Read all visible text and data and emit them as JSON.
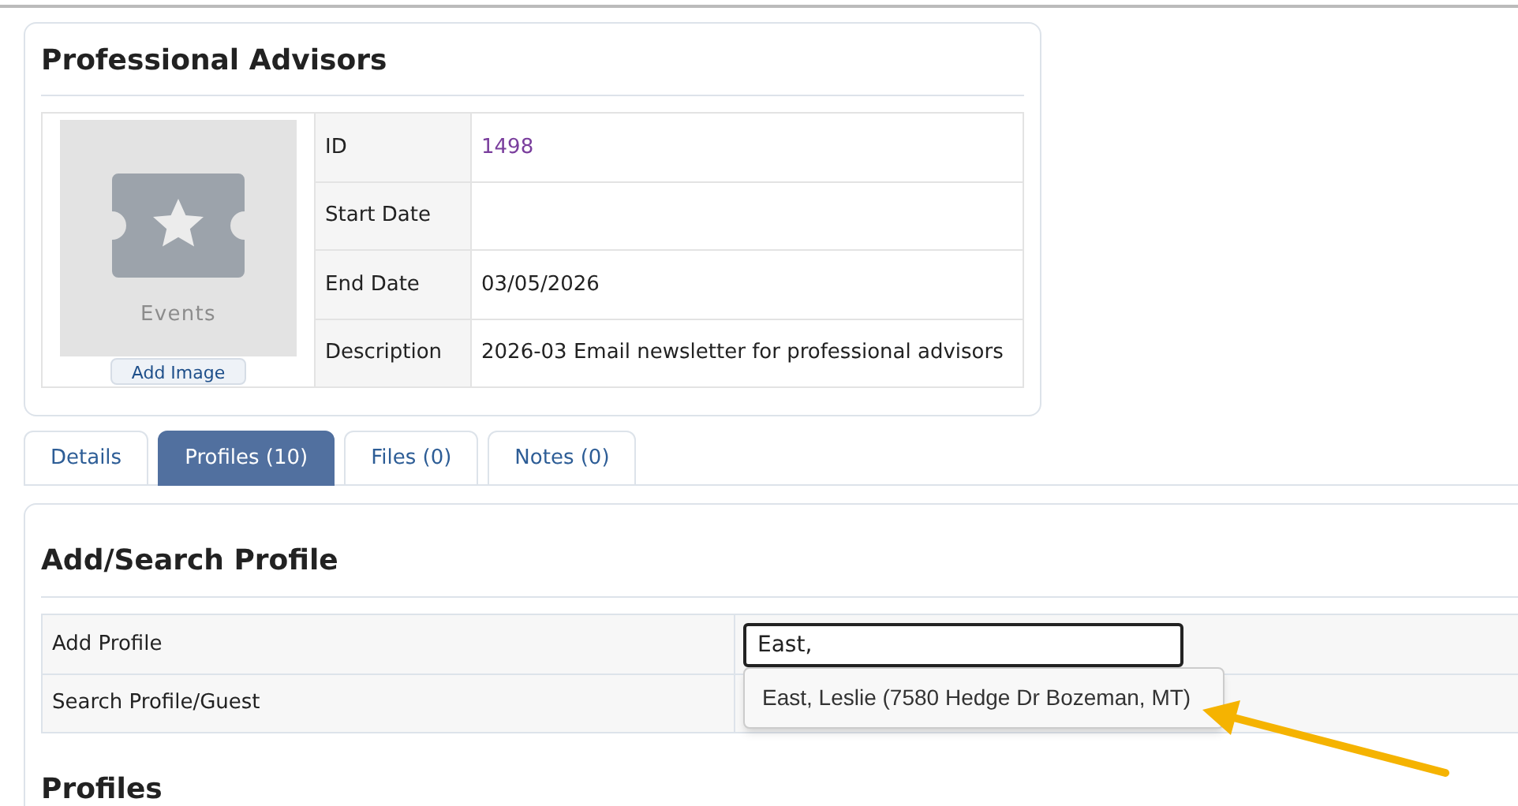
{
  "card": {
    "title": "Professional Advisors",
    "image_label": "Events",
    "add_image_button": "Add Image",
    "fields": [
      {
        "label": "ID",
        "value": "1498",
        "kind": "link"
      },
      {
        "label": "Start Date"
      },
      {
        "label": "End Date",
        "value": "03/05/2026",
        "kind": "text"
      },
      {
        "label": "Description",
        "value": "2026-03 Email newsletter for professional advisors",
        "kind": "text"
      }
    ]
  },
  "tabs": [
    {
      "label": "Details",
      "selected": false
    },
    {
      "label": "Profiles (10)",
      "selected": true
    },
    {
      "label": "Files (0)",
      "selected": false
    },
    {
      "label": "Notes (0)",
      "selected": false
    }
  ],
  "section": {
    "title": "Add/Search Profile",
    "rows": [
      {
        "label": "Add Profile",
        "kind": "input",
        "value": "East,"
      },
      {
        "label": "Search Profile/Guest",
        "kind": "plain"
      }
    ],
    "suggestions": [
      "East, Leslie (7580 Hedge Dr Bozeman, MT)"
    ]
  },
  "profiles_title": "Profiles"
}
